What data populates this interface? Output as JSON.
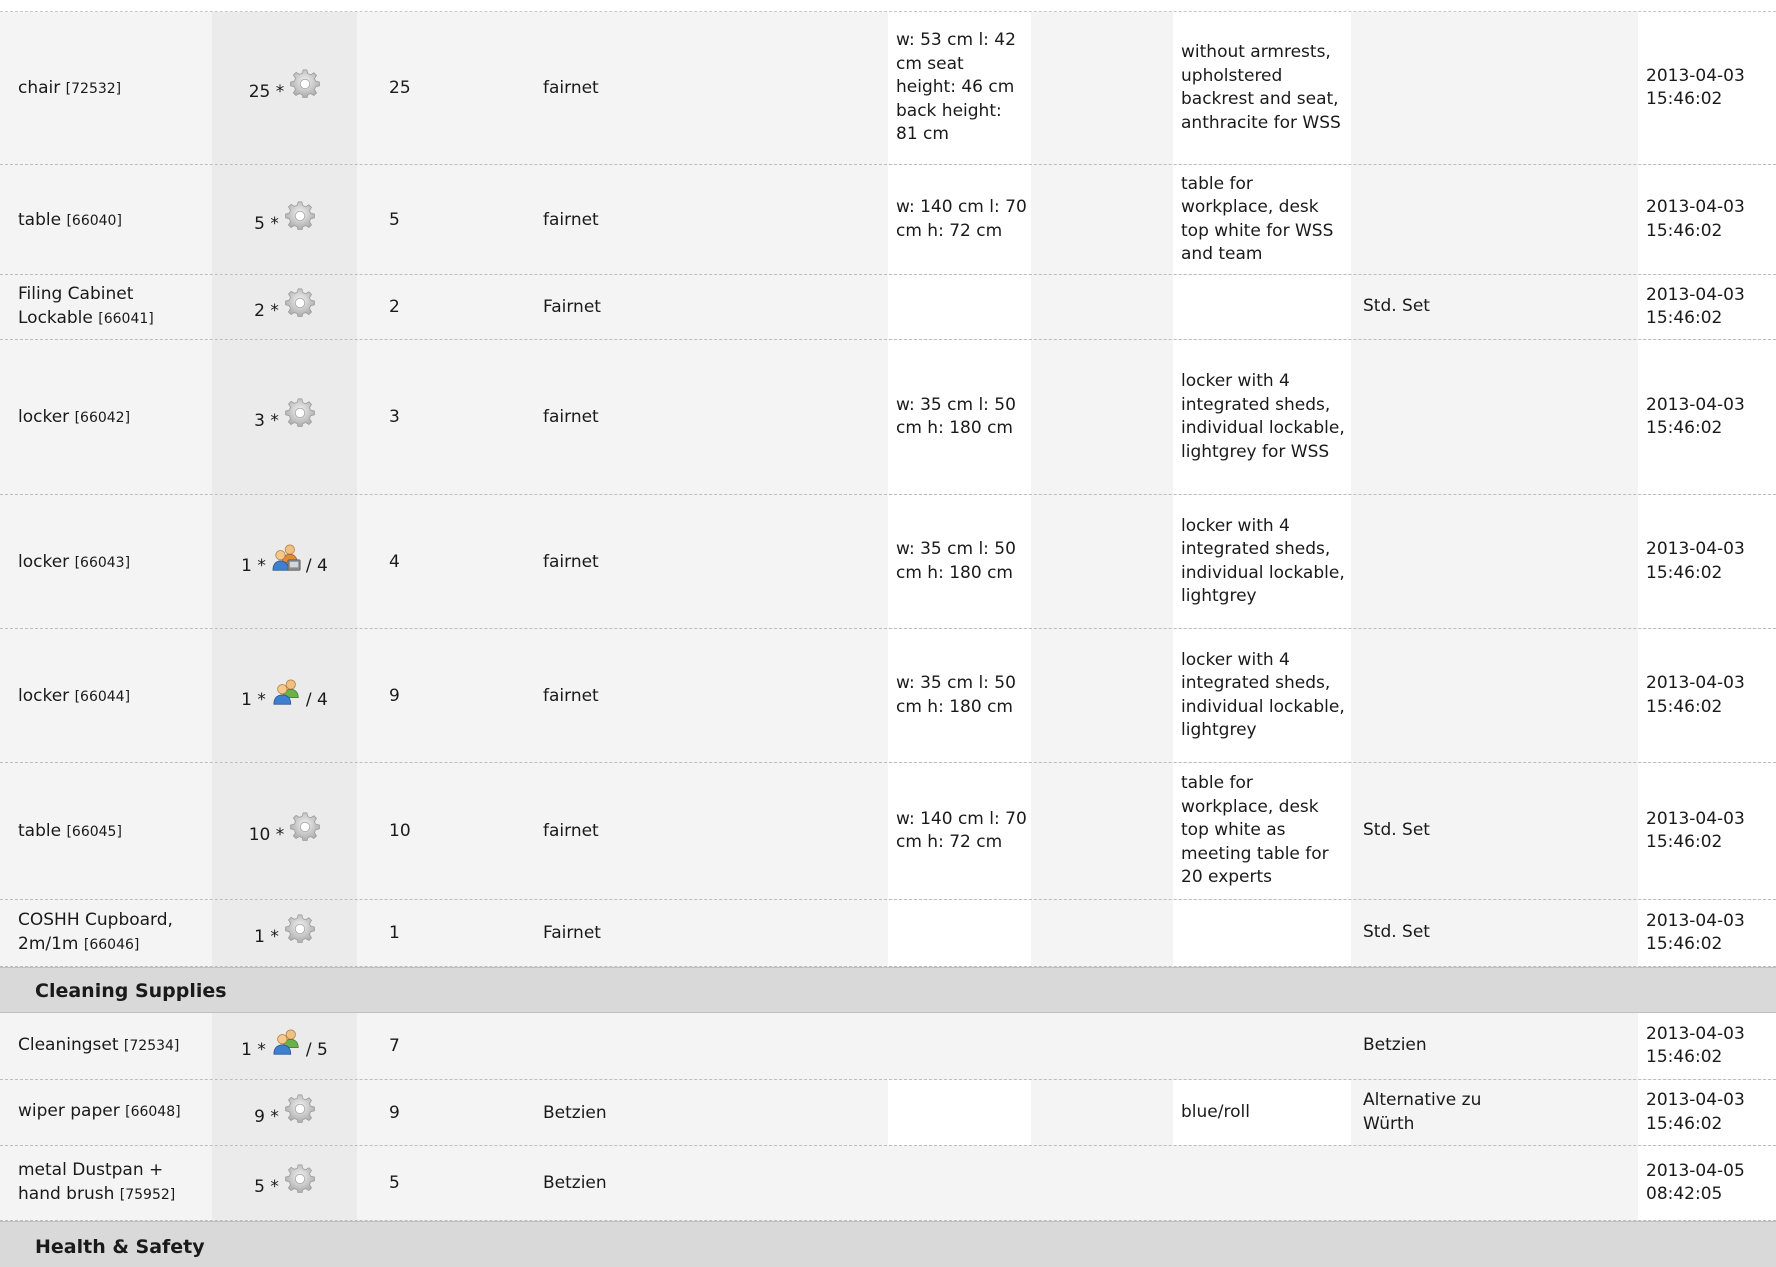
{
  "rows": [
    {
      "name": "chair",
      "id": "[72532]",
      "qty": "25 *",
      "qty_icon": "gear-icon",
      "qty_suffix": "",
      "total": "25",
      "supplier": "fairnet",
      "dimensions": "w: 53 cm l: 42 cm seat height: 46 cm back height: 81 cm",
      "description": "without armrests, upholstered backrest and seat, anthracite for WSS",
      "note": "",
      "date": "2013-04-03 15:46:02"
    },
    {
      "name": "table",
      "id": "[66040]",
      "qty": "5 *",
      "qty_icon": "gear-icon",
      "qty_suffix": "",
      "total": "5",
      "supplier": "fairnet",
      "dimensions": "w: 140 cm l: 70 cm h: 72 cm",
      "description": "table for workplace, desk top white for WSS and team",
      "note": "",
      "date": "2013-04-03 15:46:02"
    },
    {
      "name": "Filing Cabinet Lockable",
      "id": "[66041]",
      "qty": "2 *",
      "qty_icon": "gear-icon",
      "qty_suffix": "",
      "total": "2",
      "supplier": "Fairnet",
      "dimensions": "",
      "description": "",
      "note": "Std. Set",
      "date": "2013-04-03 15:46:02"
    },
    {
      "name": "locker",
      "id": "[66042]",
      "qty": "3 *",
      "qty_icon": "gear-icon",
      "qty_suffix": "",
      "total": "3",
      "supplier": "fairnet",
      "dimensions": "w: 35 cm l: 50 cm h: 180 cm",
      "description": "locker with 4 integrated sheds, individual lockable, lightgrey for WSS",
      "note": "",
      "date": "2013-04-03 15:46:02"
    },
    {
      "name": "locker",
      "id": "[66043]",
      "qty": "1 *",
      "qty_icon": "person-device-icon",
      "qty_suffix": "/ 4",
      "total": "4",
      "supplier": "fairnet",
      "dimensions": "w: 35 cm l: 50 cm h: 180 cm",
      "description": "locker with 4 integrated sheds, individual lockable, lightgrey",
      "note": "",
      "date": "2013-04-03 15:46:02"
    },
    {
      "name": "locker",
      "id": "[66044]",
      "qty": "1 *",
      "qty_icon": "people-icon",
      "qty_suffix": "/ 4",
      "total": "9",
      "supplier": "fairnet",
      "dimensions": "w: 35 cm l: 50 cm h: 180 cm",
      "description": "locker with 4 integrated sheds, individual lockable, lightgrey",
      "note": "",
      "date": "2013-04-03 15:46:02"
    },
    {
      "name": "table",
      "id": "[66045]",
      "qty": "10 *",
      "qty_icon": "gear-icon",
      "qty_suffix": "",
      "total": "10",
      "supplier": "fairnet",
      "dimensions": "w: 140 cm l: 70 cm h: 72 cm",
      "description": "table for workplace, desk top white as meeting table for 20 experts",
      "note": "Std. Set",
      "date": "2013-04-03 15:46:02"
    },
    {
      "name": "COSHH Cupboard, 2m/1m",
      "id": "[66046]",
      "qty": "1 *",
      "qty_icon": "gear-icon",
      "qty_suffix": "",
      "total": "1",
      "supplier": "Fairnet",
      "dimensions": "",
      "description": "",
      "note": "Std. Set",
      "date": "2013-04-03 15:46:02"
    },
    {
      "name": "Cleaningset",
      "id": "[72534]",
      "qty": "1 *",
      "qty_icon": "people-icon",
      "qty_suffix": "/ 5",
      "total": "7",
      "supplier": "",
      "dimensions": "",
      "description": "",
      "note": "Betzien",
      "date": "2013-04-03 15:46:02"
    },
    {
      "name": "wiper paper",
      "id": "[66048]",
      "qty": "9 *",
      "qty_icon": "gear-icon",
      "qty_suffix": "",
      "total": "9",
      "supplier": "Betzien",
      "dimensions": "",
      "description": "blue/roll",
      "note": "Alternative zu Würth",
      "date": "2013-04-03 15:46:02"
    },
    {
      "name": "metal Dustpan + hand brush",
      "id": "[75952]",
      "qty": "5 *",
      "qty_icon": "gear-icon",
      "qty_suffix": "",
      "total": "5",
      "supplier": "Betzien",
      "dimensions": "",
      "description": "",
      "note": "",
      "date": "2013-04-05 08:42:05"
    }
  ],
  "sections": {
    "cleaning": "Cleaning Supplies",
    "health": "Health & Safety"
  }
}
